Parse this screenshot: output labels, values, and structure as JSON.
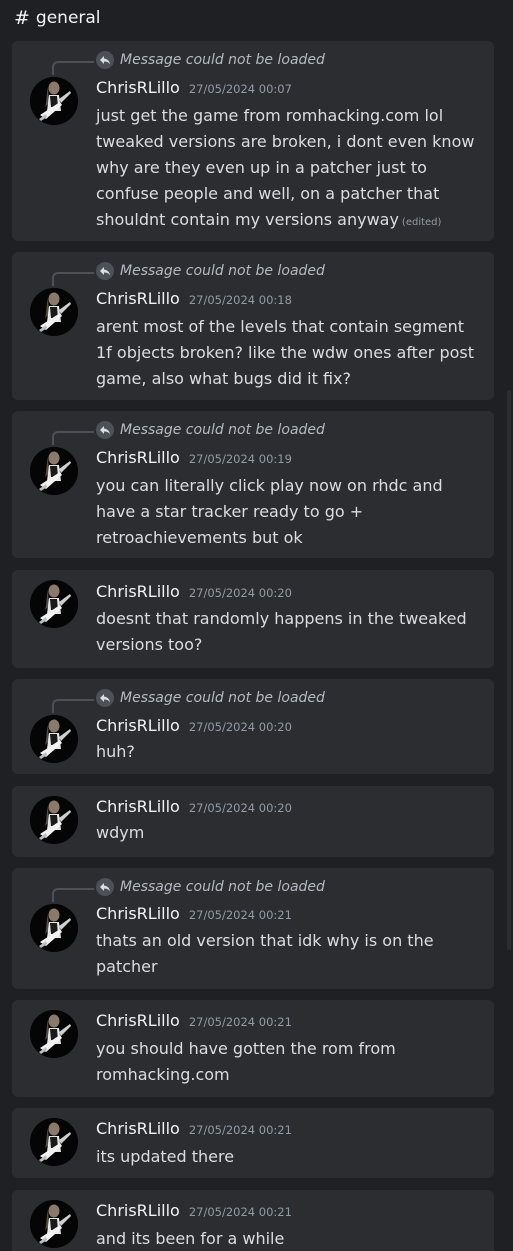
{
  "channel": {
    "name": "general"
  },
  "reply_text": "Message could not be loaded",
  "edited_label": "(edited)",
  "messages": [
    {
      "author": "ChrisRLillo",
      "timestamp": "27/05/2024 00:07",
      "lines": [
        "just get the game from romhacking.com lol",
        "tweaked versions are broken, i dont even know",
        "why are they even up in a patcher just to",
        "confuse people and well, on a patcher that",
        "shouldnt contain my versions anyway"
      ]
    },
    {
      "author": "ChrisRLillo",
      "timestamp": "27/05/2024 00:18",
      "lines": [
        "arent most of the levels that contain segment",
        "1f objects broken? like the wdw ones after post",
        "game, also what bugs did it fix?"
      ]
    },
    {
      "author": "ChrisRLillo",
      "timestamp": "27/05/2024 00:19",
      "lines": [
        "you can literally click play now on rhdc and",
        "have a star tracker ready to go +",
        "retroachievements but ok"
      ]
    },
    {
      "author": "ChrisRLillo",
      "timestamp": "27/05/2024 00:20",
      "lines": [
        "doesnt that randomly happens in the tweaked",
        "versions too?"
      ]
    },
    {
      "author": "ChrisRLillo",
      "timestamp": "27/05/2024 00:20",
      "lines": [
        "huh?"
      ]
    },
    {
      "author": "ChrisRLillo",
      "timestamp": "27/05/2024 00:20",
      "lines": [
        "wdym"
      ]
    },
    {
      "author": "ChrisRLillo",
      "timestamp": "27/05/2024 00:21",
      "lines": [
        "thats an old version that idk why is on the",
        "patcher"
      ]
    },
    {
      "author": "ChrisRLillo",
      "timestamp": "27/05/2024 00:21",
      "lines": [
        "you should have gotten the rom from",
        "romhacking.com"
      ]
    },
    {
      "author": "ChrisRLillo",
      "timestamp": "27/05/2024 00:21",
      "lines": [
        "its updated there"
      ]
    },
    {
      "author": "ChrisRLillo",
      "timestamp": "27/05/2024 00:21",
      "lines": [
        "and its been for a while"
      ]
    }
  ]
}
